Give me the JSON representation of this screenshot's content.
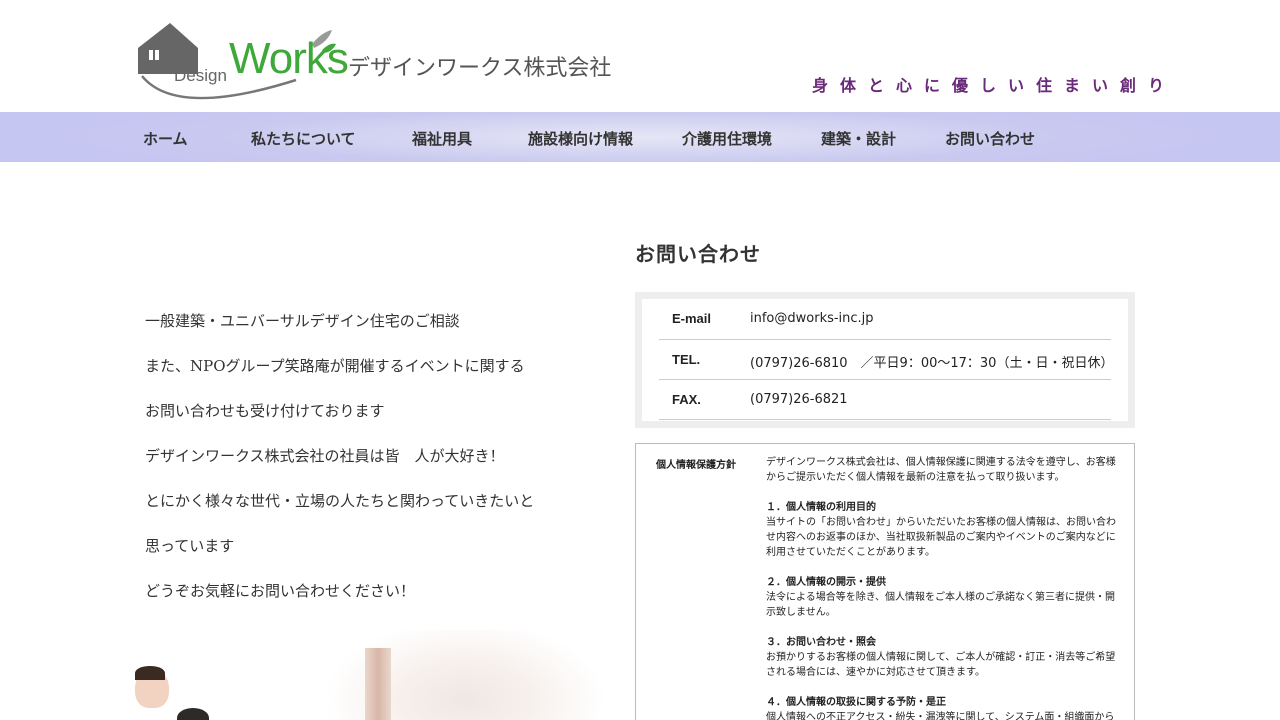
{
  "header": {
    "logo_design": "Design",
    "logo_works": "Works",
    "company_name": "デザインワークス株式会社",
    "tagline": "身体と心に優しい住まい創り",
    "brand_green": "#3ea83a",
    "tagline_color": "#6a2a7a"
  },
  "nav": {
    "items": [
      {
        "label": "ホーム"
      },
      {
        "label": "私たちについて"
      },
      {
        "label": "福祉用具"
      },
      {
        "label": "施設様向け情報"
      },
      {
        "label": "介護用住環境"
      },
      {
        "label": "建築・設計"
      },
      {
        "label": "お問い合わせ"
      }
    ]
  },
  "intro": {
    "lines": [
      "一般建築・ユニバーサルデザイン住宅のご相談",
      "また、NPOグループ笑路庵が開催するイベントに関する",
      "お問い合わせも受け付けております",
      "デザインワークス株式会社の社員は皆　人が大好き！",
      "とにかく様々な世代・立場の人たちと関わっていきたいと",
      "思っています",
      "どうぞお気軽にお問い合わせください！"
    ]
  },
  "contact": {
    "title": "お問い合わせ",
    "rows": [
      {
        "label": "E-mail",
        "value": "info@dworks-inc.jp"
      },
      {
        "label": "TEL.",
        "value": "(0797)26-6810　／平日9：00〜17：30（土・日・祝日休）"
      },
      {
        "label": "FAX.",
        "value": "(0797)26-6821"
      }
    ]
  },
  "policy": {
    "label": "個人情報保護方針",
    "intro": "デザインワークス株式会社は、個人情報保護に関連する法令を遵守し、お客様からご提示いただく個人情報を最新の注意を払って取り扱います。",
    "sections": [
      {
        "heading": "１．個人情報の利用目的",
        "text": "当サイトの「お問い合わせ」からいただいたお客様の個人情報は、お問い合わせ内容へのお返事のほか、当社取扱新製品のご案内やイベントのご案内などに利用させていただくことがあります。"
      },
      {
        "heading": "２．個人情報の開示・提供",
        "text": "法令による場合等を除き、個人情報をご本人様のご承諾なく第三者に提供・開示致しません。"
      },
      {
        "heading": "３．お問い合わせ・照会",
        "text": "お預かりするお客様の個人情報に関して、ご本人が確認・訂正・消去等ご希望される場合には、速やかに対応させて頂きます。"
      },
      {
        "heading": "４．個人情報の取扱に関する予防・是正",
        "text": "個人情報への不正アクセス・紛失・漏洩等に関して、システム面・組織面から"
      }
    ]
  }
}
